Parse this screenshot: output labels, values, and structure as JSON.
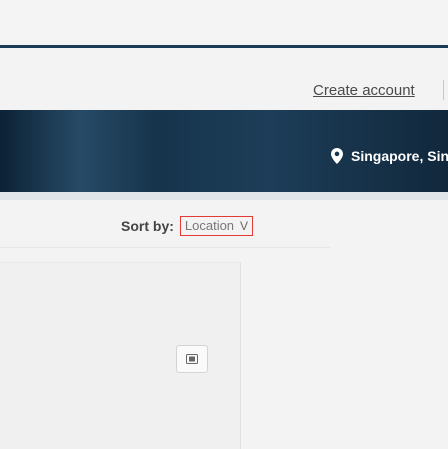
{
  "header": {
    "create_account": "Create account"
  },
  "hero": {
    "location": "Singapore, Singa"
  },
  "sort": {
    "label": "Sort by:",
    "value": "Location",
    "chevron": "V"
  },
  "icons": {
    "pin": "location-pin-icon",
    "action": "image-icon"
  },
  "colors": {
    "accent_border": "#e53935",
    "hero_dark": "#0c2235"
  }
}
